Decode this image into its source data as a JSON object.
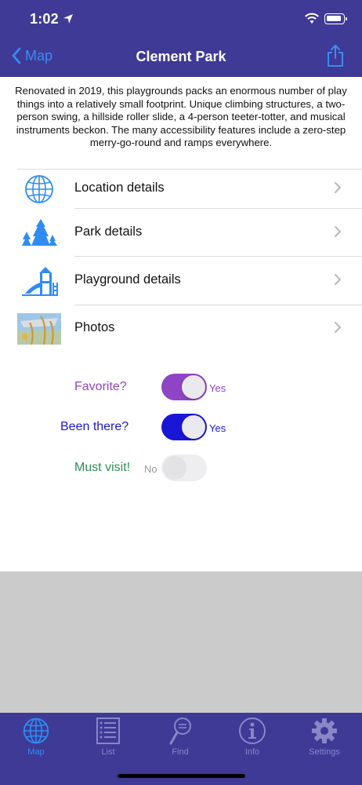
{
  "status_bar": {
    "time": "1:02"
  },
  "nav": {
    "back_label": "Map",
    "title": "Clement Park"
  },
  "description": "Renovated in 2019, this playgrounds packs an enormous number of play things into a relatively small footprint. Unique climbing structures, a two-person swing, a hillside roller slide, a 4-person teeter-totter, and musical instruments beckon. The many accessibility features include a zero-step merry-go-round and ramps everywhere.",
  "rows": [
    {
      "label": "Location details",
      "icon": "globe-icon"
    },
    {
      "label": "Park details",
      "icon": "trees-icon"
    },
    {
      "label": "Playground details",
      "icon": "playground-icon"
    },
    {
      "label": "Photos",
      "icon": "photo-thumbnail"
    }
  ],
  "toggles": [
    {
      "label": "Favorite?",
      "state": "Yes",
      "on": true,
      "color": "#8e44c4"
    },
    {
      "label": "Been there?",
      "state": "Yes",
      "on": true,
      "color": "#1a16d6"
    },
    {
      "label": "Must visit!",
      "state": "No",
      "on": false,
      "color": "#2f8f55"
    }
  ],
  "tabs": [
    {
      "label": "Map",
      "icon": "globe-icon",
      "active": true
    },
    {
      "label": "List",
      "icon": "list-icon",
      "active": false
    },
    {
      "label": "Find",
      "icon": "find-icon",
      "active": false
    },
    {
      "label": "Info",
      "icon": "info-icon",
      "active": false
    },
    {
      "label": "Settings",
      "icon": "gear-icon",
      "active": false
    }
  ],
  "colors": {
    "header": "#3e3a96",
    "accent": "#3b8cf5",
    "gray_area": "#cbcbcb"
  }
}
